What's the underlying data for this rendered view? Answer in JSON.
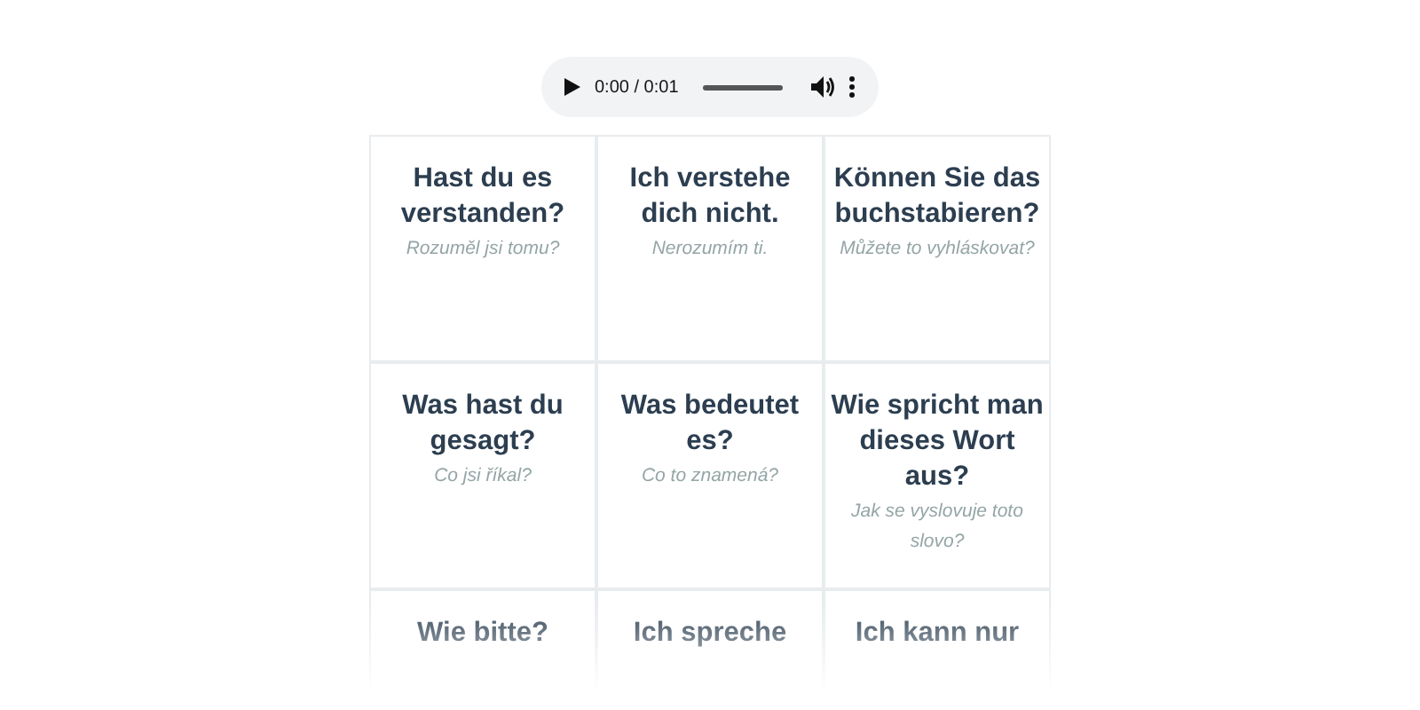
{
  "audio": {
    "time": "0:00 / 0:01",
    "level": 0
  },
  "cards": [
    {
      "phrase": "Hast du es verstanden?",
      "translation": "Rozuměl jsi tomu?"
    },
    {
      "phrase": "Ich verstehe dich nicht.",
      "translation": "Nerozumím ti."
    },
    {
      "phrase": "Können Sie das buchstabieren?",
      "translation": "Můžete to vyhláskovat?"
    },
    {
      "phrase": "Was hast du gesagt?",
      "translation": "Co jsi říkal?"
    },
    {
      "phrase": "Was bedeutet es?",
      "translation": "Co to znamená?"
    },
    {
      "phrase": "Wie spricht man dieses Wort aus?",
      "translation": "Jak se vyslovuje toto slovo?"
    },
    {
      "phrase": "Wie bitte?"
    },
    {
      "phrase": "Ich spreche"
    },
    {
      "phrase": "Ich kann nur"
    }
  ]
}
